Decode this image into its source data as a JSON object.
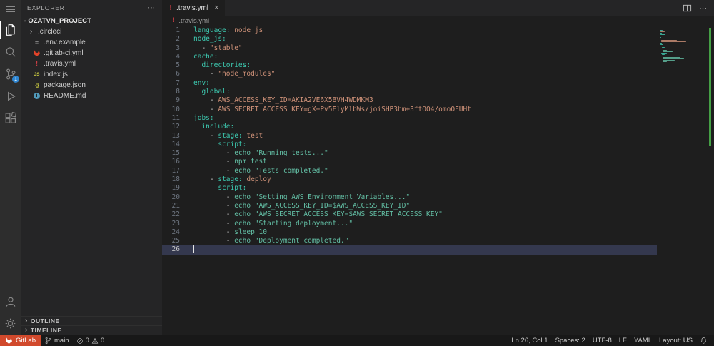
{
  "colors": {
    "key": "#3dc9b0",
    "value": "#ce9178",
    "string": "#63bfa5",
    "punct": "#d4d4d4",
    "gitlab_orange": "#d1492c",
    "scm_badge_blue": "#2f86d1",
    "travis_red": "#cc3e44",
    "js_yellow": "#cbcb41",
    "readme_blue": "#519aba",
    "git_added_green": "#4db74d"
  },
  "activity_bar": {
    "scm_badge": "1"
  },
  "sidebar": {
    "title": "EXPLORER",
    "actions": "⋯",
    "project": "OZATVN_PROJECT",
    "files": [
      {
        "label": ".circleci",
        "icon": "folder"
      },
      {
        "label": ".env.example",
        "icon": "env"
      },
      {
        "label": ".gitlab-ci.yml",
        "icon": "gitlab"
      },
      {
        "label": ".travis.yml",
        "icon": "travis"
      },
      {
        "label": "index.js",
        "icon": "js"
      },
      {
        "label": "package.json",
        "icon": "json"
      },
      {
        "label": "README.md",
        "icon": "readme"
      }
    ],
    "sections": [
      {
        "label": "OUTLINE"
      },
      {
        "label": "TIMELINE"
      }
    ]
  },
  "editor": {
    "tab": {
      "label": ".travis.yml",
      "close": "×"
    },
    "tab_actions_more": "⋯",
    "breadcrumb": {
      "label": ".travis.yml"
    },
    "cursor_line": 26,
    "lines": [
      {
        "n": 1,
        "t": [
          [
            "k",
            "language:"
          ],
          [
            "v",
            " node_js"
          ]
        ]
      },
      {
        "n": 2,
        "t": [
          [
            "k",
            "node_js:"
          ]
        ]
      },
      {
        "n": 3,
        "t": [
          [
            "d",
            "  - "
          ],
          [
            "v",
            "\"stable\""
          ]
        ]
      },
      {
        "n": 4,
        "t": [
          [
            "k",
            "cache:"
          ]
        ]
      },
      {
        "n": 5,
        "t": [
          [
            "d",
            "  "
          ],
          [
            "k",
            "directories:"
          ]
        ]
      },
      {
        "n": 6,
        "t": [
          [
            "d",
            "    - "
          ],
          [
            "v",
            "\"node_modules\""
          ]
        ]
      },
      {
        "n": 7,
        "t": [
          [
            "k",
            "env:"
          ]
        ]
      },
      {
        "n": 8,
        "t": [
          [
            "d",
            "  "
          ],
          [
            "k",
            "global:"
          ]
        ]
      },
      {
        "n": 9,
        "t": [
          [
            "d",
            "    - "
          ],
          [
            "v",
            "AWS_ACCESS_KEY_ID=AKIA2VE6X5BVH4WDMKM3"
          ]
        ]
      },
      {
        "n": 10,
        "t": [
          [
            "d",
            "    - "
          ],
          [
            "v",
            "AWS_SECRET_ACCESS_KEY=gX+Pv5ElyMlbWs/joiSHP3hm+3ftOO4/omoOFUHt"
          ]
        ]
      },
      {
        "n": 11,
        "t": [
          [
            "k",
            "jobs:"
          ]
        ]
      },
      {
        "n": 12,
        "t": [
          [
            "d",
            "  "
          ],
          [
            "k",
            "include:"
          ]
        ]
      },
      {
        "n": 13,
        "t": [
          [
            "d",
            "    - "
          ],
          [
            "k",
            "stage:"
          ],
          [
            "v",
            " test"
          ]
        ]
      },
      {
        "n": 14,
        "t": [
          [
            "d",
            "      "
          ],
          [
            "k",
            "script:"
          ]
        ]
      },
      {
        "n": 15,
        "t": [
          [
            "d",
            "        - "
          ],
          [
            "s",
            "echo \"Running tests...\""
          ]
        ]
      },
      {
        "n": 16,
        "t": [
          [
            "d",
            "        - "
          ],
          [
            "s",
            "npm test"
          ]
        ]
      },
      {
        "n": 17,
        "t": [
          [
            "d",
            "        - "
          ],
          [
            "s",
            "echo \"Tests completed.\""
          ]
        ]
      },
      {
        "n": 18,
        "t": [
          [
            "d",
            "    - "
          ],
          [
            "k",
            "stage:"
          ],
          [
            "v",
            " deploy"
          ]
        ]
      },
      {
        "n": 19,
        "t": [
          [
            "d",
            "      "
          ],
          [
            "k",
            "script:"
          ]
        ]
      },
      {
        "n": 20,
        "t": [
          [
            "d",
            "        - "
          ],
          [
            "s",
            "echo \"Setting AWS Environment Variables...\""
          ]
        ]
      },
      {
        "n": 21,
        "t": [
          [
            "d",
            "        - "
          ],
          [
            "s",
            "echo \"AWS_ACCESS_KEY_ID=$AWS_ACCESS_KEY_ID\""
          ]
        ]
      },
      {
        "n": 22,
        "t": [
          [
            "d",
            "        - "
          ],
          [
            "s",
            "echo \"AWS_SECRET_ACCESS_KEY=$AWS_SECRET_ACCESS_KEY\""
          ]
        ]
      },
      {
        "n": 23,
        "t": [
          [
            "d",
            "        - "
          ],
          [
            "s",
            "echo \"Starting deployment...\""
          ]
        ]
      },
      {
        "n": 24,
        "t": [
          [
            "d",
            "        - "
          ],
          [
            "s",
            "sleep 10"
          ]
        ]
      },
      {
        "n": 25,
        "t": [
          [
            "d",
            "        - "
          ],
          [
            "s",
            "echo \"Deployment completed.\""
          ]
        ]
      },
      {
        "n": 26,
        "t": []
      }
    ]
  },
  "status_bar": {
    "gitlab": {
      "label": "GitLab"
    },
    "branch": {
      "label": "main"
    },
    "errors": {
      "count": "0"
    },
    "warnings": {
      "count": "0"
    },
    "right": [
      {
        "name": "cursor-position",
        "label": "Ln 26, Col 1"
      },
      {
        "name": "indentation",
        "label": "Spaces: 2"
      },
      {
        "name": "encoding",
        "label": "UTF-8"
      },
      {
        "name": "eol",
        "label": "LF"
      },
      {
        "name": "language-mode",
        "label": "YAML"
      },
      {
        "name": "keyboard-layout",
        "label": "Layout: US"
      }
    ]
  }
}
